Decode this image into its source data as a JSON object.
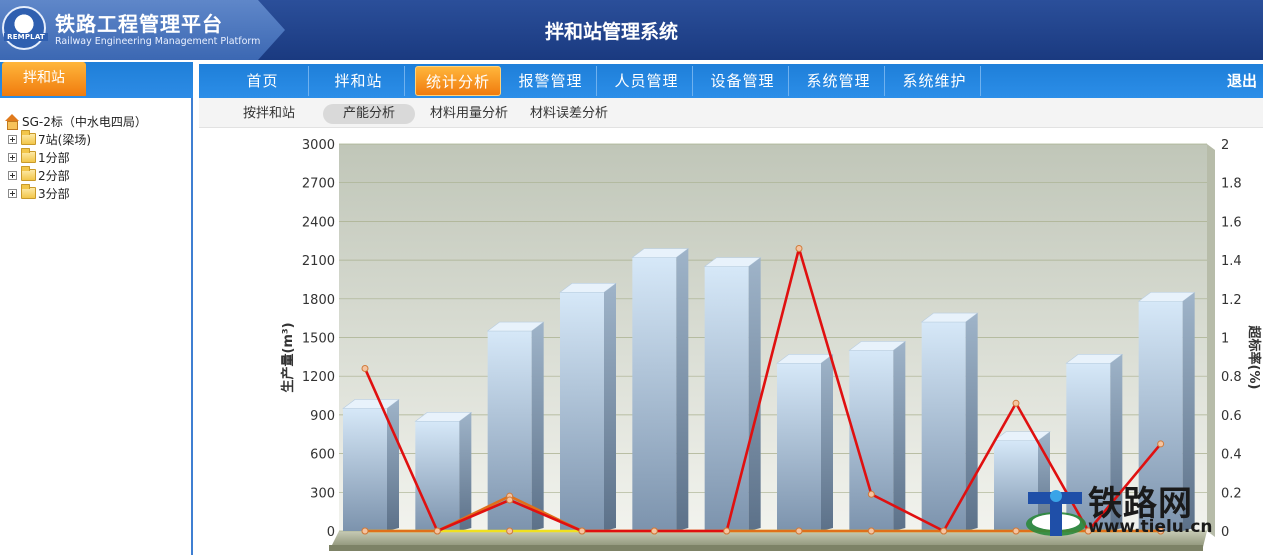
{
  "header": {
    "logo_text": "REMPLAT",
    "platform_title": "铁路工程管理平台",
    "platform_subtitle": "Railway Engineering Management Platform",
    "system_title": "拌和站管理系统"
  },
  "left_panel": {
    "tab_label": "拌和站",
    "tree": {
      "root_label": "SG-2标（中水电四局）",
      "children": [
        {
          "label": "7站(梁场)"
        },
        {
          "label": "1分部"
        },
        {
          "label": "2分部"
        },
        {
          "label": "3分部"
        }
      ]
    }
  },
  "main_nav": {
    "items": [
      {
        "label": "首页"
      },
      {
        "label": "拌和站"
      },
      {
        "label": "统计分析"
      },
      {
        "label": "报警管理"
      },
      {
        "label": "人员管理"
      },
      {
        "label": "设备管理"
      },
      {
        "label": "系统管理"
      },
      {
        "label": "系统维护"
      }
    ],
    "active_index": 2,
    "logout_label": "退出"
  },
  "sub_nav": {
    "items": [
      {
        "label": "按拌和站"
      },
      {
        "label": "产能分析"
      },
      {
        "label": "材料用量分析"
      },
      {
        "label": "材料误差分析"
      }
    ],
    "active_index": 1
  },
  "colors": {
    "nav_blue": "#2b8ae4",
    "active_orange": "#f39a22",
    "bar_top": "#d4e6f7",
    "bar_bottom": "#7f98b3",
    "red_line": "#e01010",
    "orange_line": "#e0701a",
    "yellow_line": "#f0e020"
  },
  "chart_data": {
    "type": "bar",
    "ylabel": "生产量(m³)",
    "y2label": "超标率(%)",
    "ylim": [
      0,
      3000
    ],
    "yticks": [
      0,
      300,
      600,
      900,
      1200,
      1500,
      1800,
      2100,
      2400,
      2700,
      3000
    ],
    "y2lim": [
      0,
      2
    ],
    "y2ticks": [
      "0",
      "0.2",
      "0.4",
      "0.6",
      "0.8",
      "1",
      "1.2",
      "1.4",
      "1.6",
      "1.8",
      "2"
    ],
    "values": [
      950,
      850,
      1550,
      1850,
      2120,
      2050,
      1300,
      1400,
      1620,
      700,
      1300,
      1780
    ],
    "series": [
      {
        "color": "#e01010",
        "values": [
          0.84,
          0,
          0.16,
          0,
          0,
          0,
          1.46,
          0.19,
          0,
          0.66,
          0,
          0.45
        ]
      },
      {
        "color": "#e0701a",
        "values": [
          0,
          0,
          0.18,
          0,
          0,
          0,
          0,
          0,
          0,
          0,
          0,
          0
        ]
      },
      {
        "color": "#f0e020",
        "values": [
          0,
          0,
          0,
          0,
          0,
          0,
          0,
          0,
          0,
          0,
          0,
          0
        ]
      }
    ],
    "grid": true,
    "legend": "none"
  },
  "watermark": {
    "text": "铁路网",
    "url": "www.tielu.cn"
  }
}
